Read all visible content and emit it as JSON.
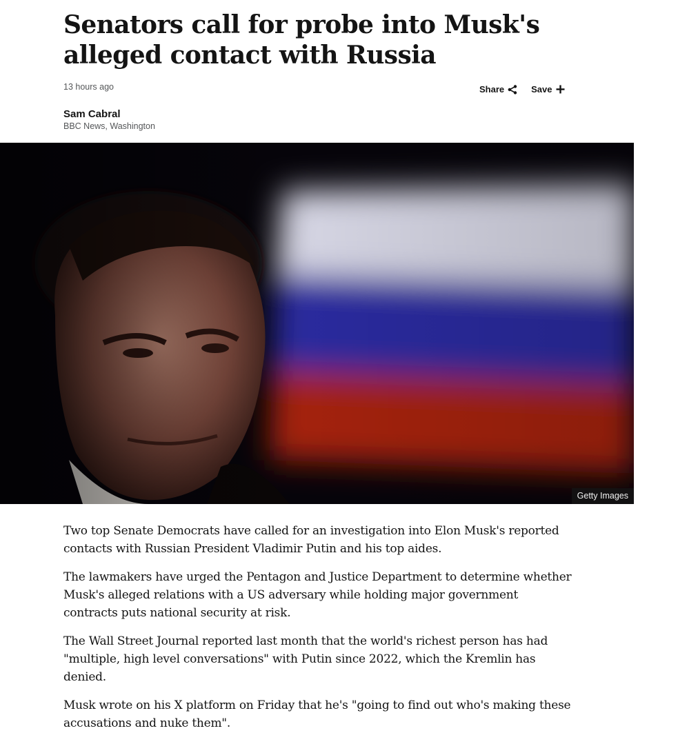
{
  "article": {
    "headline": "Senators call for probe into Musk's alleged contact with Russia",
    "timestamp": "13 hours ago",
    "byline": {
      "name": "Sam Cabral",
      "role": "BBC News, Washington"
    }
  },
  "actions": {
    "share_label": "Share",
    "share_icon": "share-icon",
    "save_label": "Save",
    "save_icon": "plus-icon"
  },
  "hero_image": {
    "credit": "Getty Images",
    "flag_colors": [
      "#dcdce8",
      "#2a2a9c",
      "#a82010"
    ]
  },
  "paragraphs": [
    "Two top Senate Democrats have called for an investigation into Elon Musk's reported contacts with Russian President Vladimir Putin and his top aides.",
    "The lawmakers have urged the Pentagon and Justice Department to determine whether Musk's alleged relations with a US adversary while holding major government contracts puts national security at risk.",
    "The Wall Street Journal reported last month that the world's richest person has had \"multiple, high level conversations\" with Putin since 2022, which the Kremlin has denied.",
    "Musk wrote on his X platform on Friday that he's \"going to find out who's making these accusations and nuke them\"."
  ]
}
